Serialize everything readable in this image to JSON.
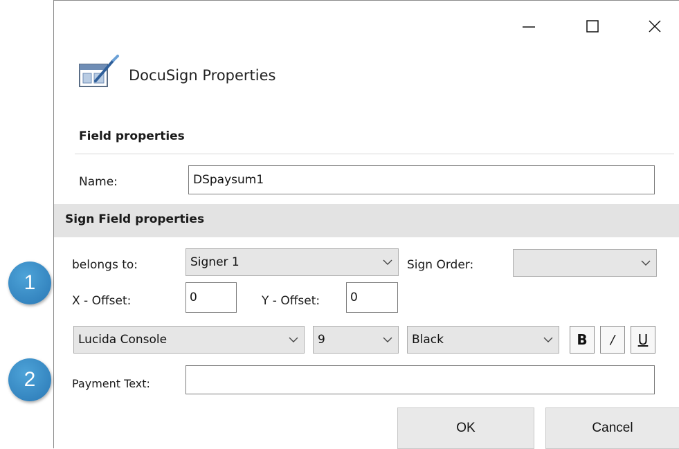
{
  "window": {
    "title": "DocuSign Properties",
    "controls": {
      "minimize": "—",
      "maximize": "☐",
      "close": "✕"
    }
  },
  "field_properties": {
    "heading": "Field properties",
    "name_label": "Name:",
    "name_value": "DSpaysum1"
  },
  "sign_field_properties": {
    "heading": "Sign Field properties",
    "belongs_to_label": "belongs to:",
    "belongs_to_value": "Signer 1",
    "sign_order_label": "Sign Order:",
    "sign_order_value": "",
    "x_offset_label": "X - Offset:",
    "x_offset_value": "0",
    "y_offset_label": "Y - Offset:",
    "y_offset_value": "0",
    "font_family": "Lucida Console",
    "font_size": "9",
    "font_color": "Black",
    "bold_label": "B",
    "italic_label": "/",
    "underline_label": "U",
    "payment_text_label": "Payment Text:",
    "payment_text_value": ""
  },
  "buttons": {
    "ok": "OK",
    "cancel": "Cancel"
  },
  "callouts": [
    "1",
    "2"
  ],
  "colors": {
    "badge": "#2f82bf",
    "section_band": "#e3e3e3"
  },
  "icons": {
    "app": "docusign-form-icon",
    "dropdown": "chevron-down-icon"
  }
}
